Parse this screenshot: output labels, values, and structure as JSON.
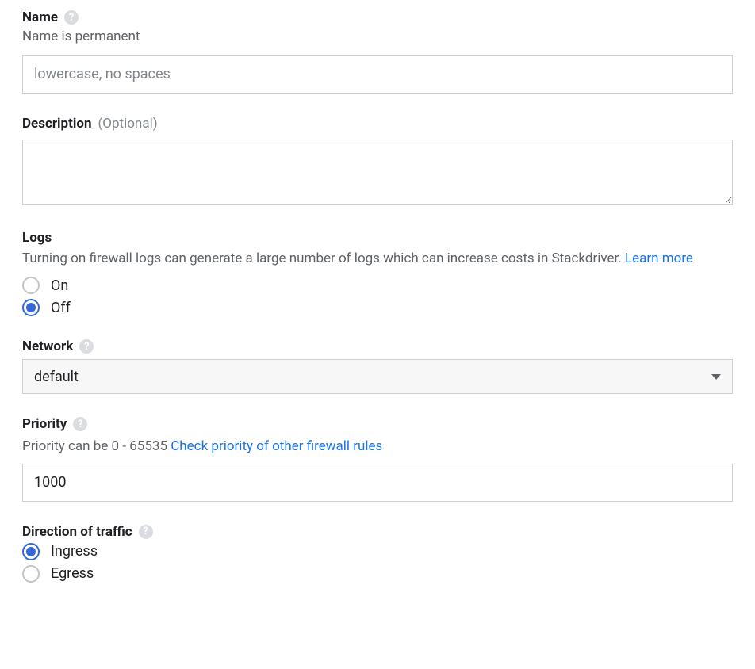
{
  "name": {
    "label": "Name",
    "help": "Name is permanent",
    "placeholder": "lowercase, no spaces",
    "value": ""
  },
  "description": {
    "label": "Description",
    "optional": "(Optional)",
    "value": ""
  },
  "logs": {
    "label": "Logs",
    "help": "Turning on firewall logs can generate a large number of logs which can increase costs in Stackdriver. ",
    "learnmore": "Learn more",
    "options": {
      "on": "On",
      "off": "Off"
    },
    "selected": "off"
  },
  "network": {
    "label": "Network",
    "value": "default"
  },
  "priority": {
    "label": "Priority",
    "help_prefix": "Priority can be 0 - 65535",
    "check_link": "Check priority of other firewall rules",
    "value": "1000"
  },
  "direction": {
    "label": "Direction of traffic",
    "options": {
      "ingress": "Ingress",
      "egress": "Egress"
    },
    "selected": "ingress"
  }
}
